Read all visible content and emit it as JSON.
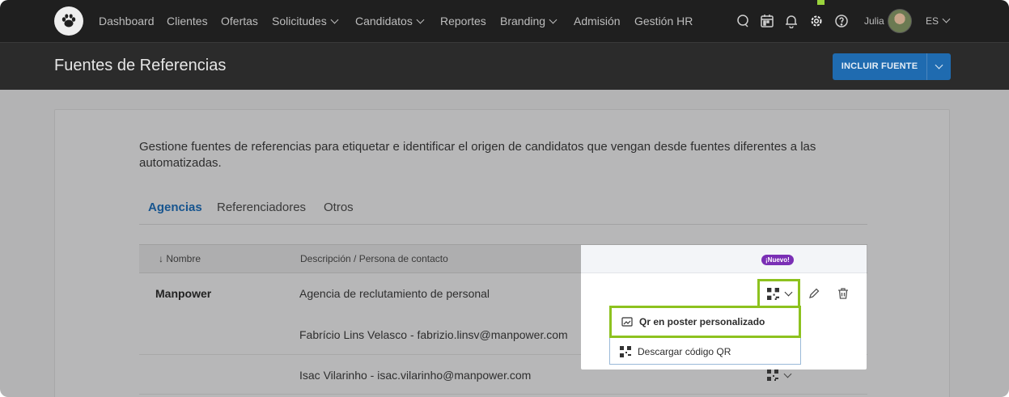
{
  "nav": {
    "items": [
      {
        "label": "Dashboard",
        "dropdown": false
      },
      {
        "label": "Clientes",
        "dropdown": false
      },
      {
        "label": "Ofertas",
        "dropdown": false
      },
      {
        "label": "Solicitudes",
        "dropdown": true
      },
      {
        "label": "Candidatos",
        "dropdown": true
      },
      {
        "label": "Reportes",
        "dropdown": false
      },
      {
        "label": "Branding",
        "dropdown": true
      },
      {
        "label": "Admisión",
        "dropdown": false
      },
      {
        "label": "Gestión HR",
        "dropdown": false
      }
    ],
    "icons": [
      "chat-icon",
      "calendar-icon",
      "bell-icon",
      "gear-icon",
      "help-icon"
    ],
    "user_name": "Julia",
    "language": "ES"
  },
  "header": {
    "title": "Fuentes de Referencias",
    "include_button": "INCLUIR FUENTE"
  },
  "main": {
    "description": "Gestione fuentes de referencias para etiquetar e identificar el origen de candidatos que vengan desde fuentes diferentes a las automatizadas.",
    "tabs": [
      {
        "label": "Agencias",
        "active": true
      },
      {
        "label": "Referenciadores",
        "active": false
      },
      {
        "label": "Otros",
        "active": false
      }
    ],
    "table": {
      "columns": [
        "↓ Nombre",
        "Descripción / Persona de contacto"
      ],
      "new_badge": "¡Nuevo!",
      "rows": [
        {
          "name": "Manpower",
          "description": "Agencia de reclutamiento de personal"
        },
        {
          "name": "",
          "description": "Fabrício Lins Velasco - fabrizio.linsv@manpower.com"
        },
        {
          "name": "",
          "description": "Isac Vilarinho - isac.vilarinho@manpower.com"
        }
      ]
    },
    "qr_menu": [
      {
        "label": "Qr en poster personalizado",
        "icon": "poster-icon"
      },
      {
        "label": "Descargar código QR",
        "icon": "qr-icon"
      }
    ]
  },
  "colors": {
    "accent": "#1f6bb0",
    "highlight": "#8dc21f",
    "badge": "#7a2fb5",
    "nav_bg": "#1f1f1f"
  }
}
